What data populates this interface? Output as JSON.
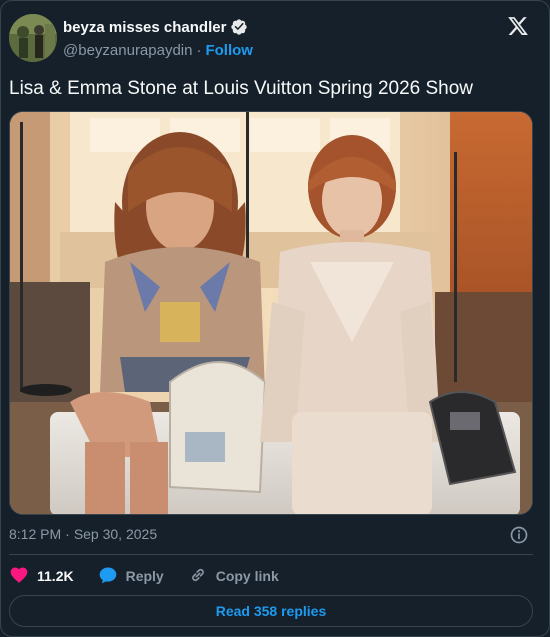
{
  "author": {
    "display_name": "beyza misses chandler",
    "handle": "@beyzanurapaydin",
    "separator": "·",
    "follow_label": "Follow"
  },
  "tweet": {
    "text": "Lisa & Emma Stone at Louis Vuitton Spring 2026 Show",
    "time": "8:12 PM",
    "date_separator": "·",
    "date": "Sep 30, 2025"
  },
  "actions": {
    "likes": "11.2K",
    "reply_label": "Reply",
    "copy_link_label": "Copy link"
  },
  "read_replies_label": "Read 358 replies",
  "colors": {
    "background": "#15202b",
    "accent": "#1d9bf0",
    "like": "#f91880",
    "muted": "#8b98a5",
    "border": "#38444d"
  },
  "icons": [
    "verified-badge-icon",
    "x-logo-icon",
    "info-icon",
    "heart-icon",
    "reply-bubble-icon",
    "link-icon"
  ]
}
